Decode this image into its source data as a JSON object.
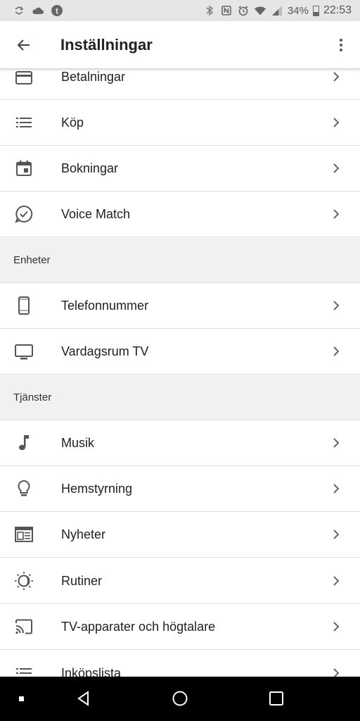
{
  "status_bar": {
    "battery_percent": "34%",
    "time": "22:53",
    "left_icons": [
      "sync-icon",
      "cloud-icon",
      "tumblr-icon"
    ],
    "right_icons": [
      "bluetooth-icon",
      "nfc-icon",
      "alarm-icon",
      "wifi-icon",
      "signal-icon",
      "battery-icon"
    ]
  },
  "app_bar": {
    "title": "Inställningar",
    "back_icon": "arrow-back-icon",
    "more_icon": "more-vert-icon"
  },
  "items": {
    "payments": {
      "label": "Betalningar",
      "icon": "credit-card-icon"
    },
    "purchases": {
      "label": "Köp",
      "icon": "list-icon"
    },
    "reservations": {
      "label": "Bokningar",
      "icon": "calendar-icon"
    },
    "voice_match": {
      "label": "Voice Match",
      "icon": "voice-match-icon"
    },
    "phone_number": {
      "label": "Telefonnummer",
      "icon": "phone-icon"
    },
    "living_room_tv": {
      "label": "Vardagsrum TV",
      "icon": "tv-icon"
    },
    "music": {
      "label": "Musik",
      "icon": "music-note-icon"
    },
    "home_control": {
      "label": "Hemstyrning",
      "icon": "lightbulb-icon"
    },
    "news": {
      "label": "Nyheter",
      "icon": "news-icon"
    },
    "routines": {
      "label": "Rutiner",
      "icon": "routines-icon"
    },
    "tv_speakers": {
      "label": "TV-apparater och högtalare",
      "icon": "cast-icon"
    },
    "shopping_list": {
      "label": "Inköpslista",
      "icon": "list-icon"
    }
  },
  "sections": {
    "devices": "Enheter",
    "services": "Tjänster"
  },
  "nav_bar": {
    "icons": [
      "recent-dot-icon",
      "back-triangle-icon",
      "home-circle-icon",
      "overview-square-icon"
    ]
  }
}
